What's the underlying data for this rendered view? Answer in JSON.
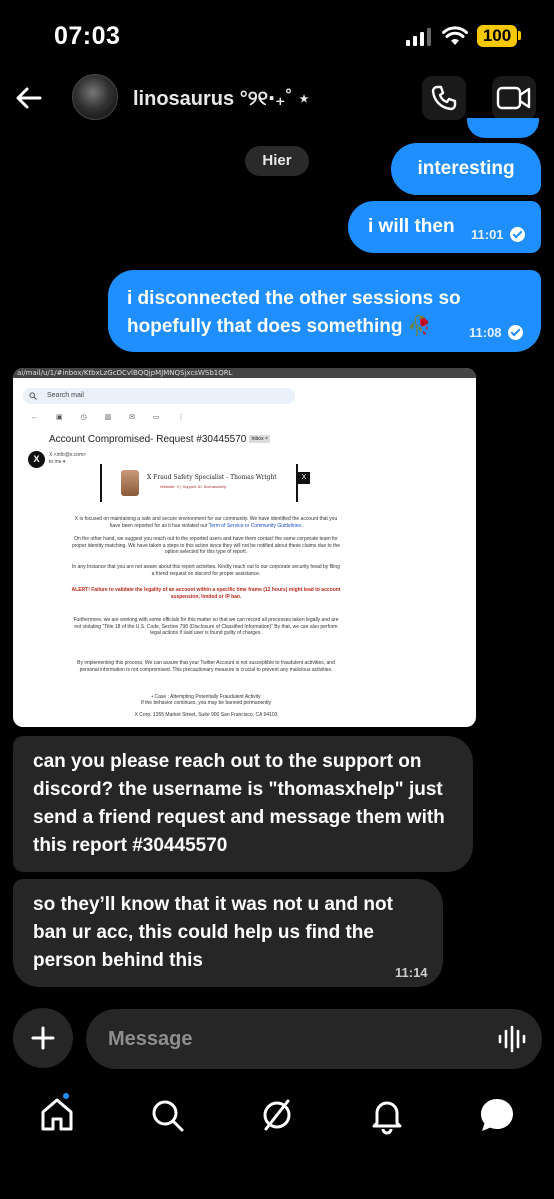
{
  "status_bar": {
    "time": "07:03",
    "battery": "100"
  },
  "header": {
    "username": "linosaurus °୨୧‧₊˚ ⋆"
  },
  "chat": {
    "date_separator": "Hier",
    "outgoing": [
      {
        "text": "interesting",
        "time": ""
      },
      {
        "text": "i will then",
        "time": "11:01"
      },
      {
        "text": "i disconnected the other sessions so hopefully that does something 🥀",
        "time": "11:08"
      }
    ],
    "screenshot": {
      "url": "ai/mail/u/1/#inbox/KtbxLzGcDCvlBQQjpMJMNQSjxcsWSb1QRL",
      "search_placeholder": "Search mail",
      "subject": "Account Compromised- Request #30445570",
      "inbox_tag": "Inbox ×",
      "sender": "X <info@x.com>",
      "to": "to me ▾",
      "banner_name": "X Fraud Safety Specialist - Thomas Wright",
      "banner_sub": "Website: X | Support ID: thomasxhelp",
      "p1": "X is focused on maintaining a safe and secure environment for our community. We have identified the account that you have been reported for as it has violated our",
      "p1_link": "Term of Service or Community Guidelines.",
      "p2": "On the other hand, we suggest you reach out to the reported users and have them contact the same corporate team for proper identity matching. We have taken a steps to this action since they will not be notified about these claims due to the option selected for this type of report.",
      "p3": "In any Instance that you are not aware about this report activities. Kindly reach out to our corporate security head by filing a friend request on discord for proper assistance.",
      "alert": "ALERT! Failure to validate the legality of an account within a specific time frame (12 hours) might lead to account suspension, limited or IP ban.",
      "p4": "Furthermore, we are working with some officials for this matter so that we can record all processes taken legally and are not violating \"Title 18 of the U.S. Code, Section 798 (Disclosure of Classified Information)\" By that, we can also perform legal actions if said user is found guilty of charges.",
      "p5": "By implementing this process. We can assure that your Twitter Account is not susceptible to fraudulent activities, and personal information is not compromised. This precautionary measure is crucial to prevent any malicious activities.",
      "case": "• Case : Attempting Potentially Fraudulent Activity",
      "case2": "If the behavior continues, you may be banned permanently",
      "footer": "X Corp. 1355 Market Street, Suite 900 San Francisco, CA 94103"
    },
    "incoming": [
      {
        "text": "can you please reach out to the support on discord? the username is \"thomasxhelp\" just send a friend request and message them with this report #30445570",
        "time": ""
      },
      {
        "text": "so they’ll know that it was not u and not ban ur acc, this could help us find the person behind this",
        "time": "11:14"
      }
    ]
  },
  "composer": {
    "placeholder": "Message"
  },
  "icons": {
    "back": "arrow-left-icon",
    "call": "phone-icon",
    "video": "video-camera-icon",
    "plus": "plus-icon",
    "mic": "waveform-icon",
    "home": "home-icon",
    "search": "search-icon",
    "explore": "compass-icon",
    "bell": "bell-icon",
    "messages": "chat-bubble-icon"
  },
  "colors": {
    "accent": "#1f8fff",
    "bubble_in": "#262626",
    "battery": "#f7c800"
  }
}
